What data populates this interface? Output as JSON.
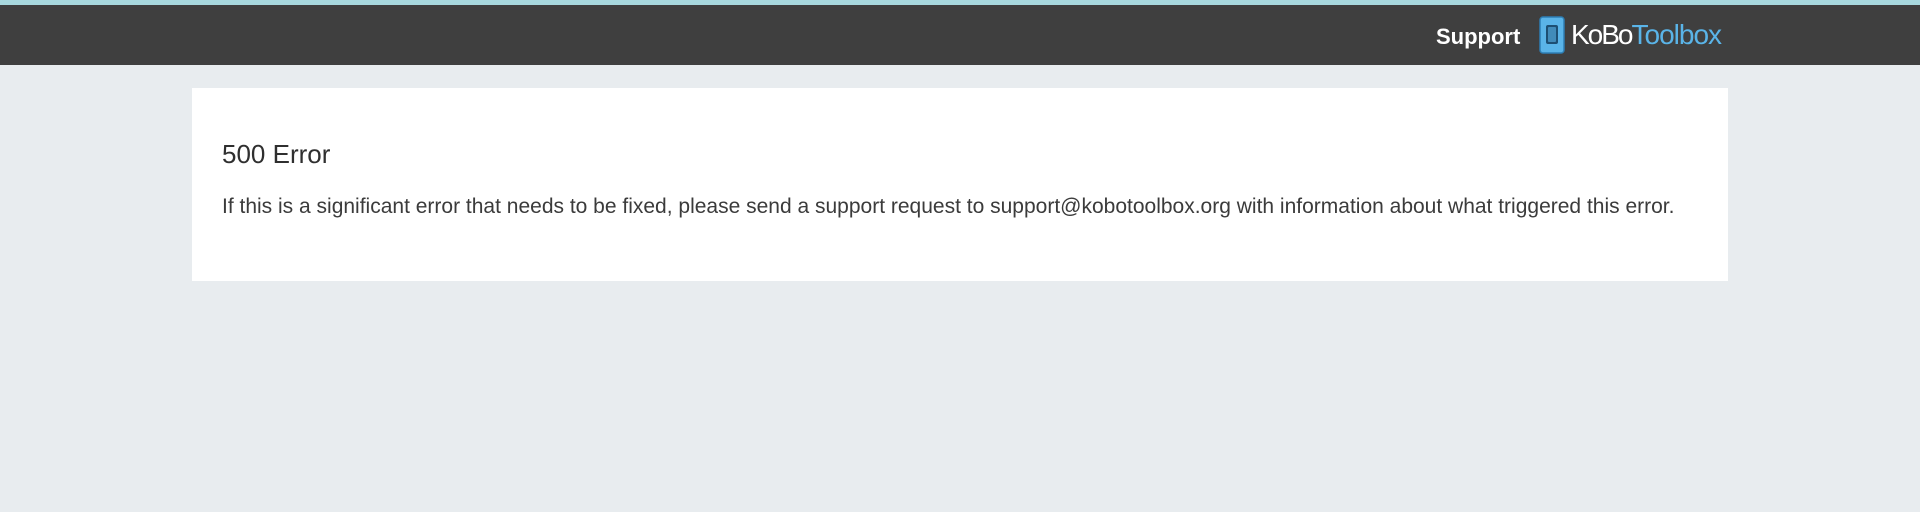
{
  "header": {
    "support_label": "Support",
    "logo": {
      "icon": "kobo-device-icon",
      "text_part1": "KoBo",
      "text_part2": "Toolbox"
    }
  },
  "error": {
    "title": "500 Error",
    "message": "If this is a significant error that needs to be fixed, please send a support request to support@kobotoolbox.org with information about what triggered this error."
  },
  "colors": {
    "accent_bar": "#a8d8de",
    "header_bg": "#3f3f3f",
    "page_bg": "#e8ecef",
    "logo_blue": "#5ab4e8"
  }
}
